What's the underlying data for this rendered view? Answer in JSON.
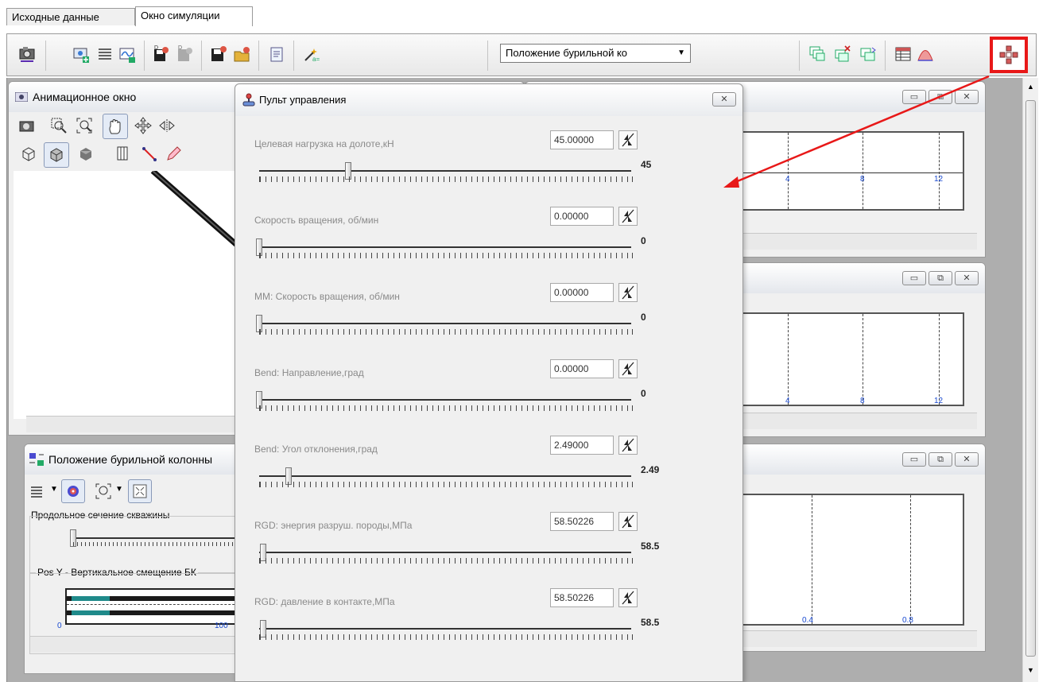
{
  "tabs": [
    {
      "label": "Исходные данные",
      "active": false
    },
    {
      "label": "Окно симуляции",
      "active": true
    }
  ],
  "toolbar": {
    "dropdown_value": "Положение бурильной ко",
    "icons": [
      "camera-icon",
      "add-window-icon",
      "list-icon",
      "chart-add-icon",
      "save-data-icon",
      "load-data-icon",
      "save-icon",
      "open-icon",
      "report-icon",
      "wizard-icon",
      "cascade-icon",
      "close-windows-icon",
      "tile-windows-icon",
      "table-icon",
      "histogram-icon",
      "control-panel-icon"
    ],
    "highlight_color": "#e81818"
  },
  "windows": {
    "animation": {
      "title": "Анимационное окно"
    },
    "drill_position": {
      "title": "Положение бурильной колонны",
      "section_label": "Продольное сечение скважины",
      "plot_label": "Pos Y - Вертикальное смещение БК",
      "axis_start": "0",
      "axis_mid": "100"
    },
    "plot1": {
      "ticks": [
        "4",
        "8",
        "12"
      ]
    },
    "plot2": {
      "ticks": [
        "4",
        "8",
        "12"
      ]
    },
    "plot3": {
      "ticks": [
        "0.4",
        "0.8"
      ]
    },
    "window_buttons": {
      "minimize": "▭",
      "restore": "⧉",
      "close": "✕"
    }
  },
  "control_panel": {
    "title": "Пульт управления",
    "close": "✕",
    "params": [
      {
        "label": "Целевая нагрузка на долоте,кН",
        "value": "45.00000",
        "slider_value": "45",
        "slider_pos": 0.24
      },
      {
        "label": "Скорость вращения, об/мин",
        "value": "0.00000",
        "slider_value": "0",
        "slider_pos": 0.0
      },
      {
        "label": "ММ: Скорость вращения, об/мин",
        "value": "0.00000",
        "slider_value": "0",
        "slider_pos": 0.0
      },
      {
        "label": "Bend: Направление,град",
        "value": "0.00000",
        "slider_value": "0",
        "slider_pos": 0.0
      },
      {
        "label": "Bend: Угол отклонения,град",
        "value": "2.49000",
        "slider_value": "2.49",
        "slider_pos": 0.08
      },
      {
        "label": "RGD: энергия разруш. породы,МПа",
        "value": "58.50226",
        "slider_value": "58.5",
        "slider_pos": 0.01
      },
      {
        "label": "RGD: давление в контакте,МПа",
        "value": "58.50226",
        "slider_value": "58.5",
        "slider_pos": 0.01
      }
    ]
  },
  "annotation": {
    "arrow_color": "#e81818"
  }
}
